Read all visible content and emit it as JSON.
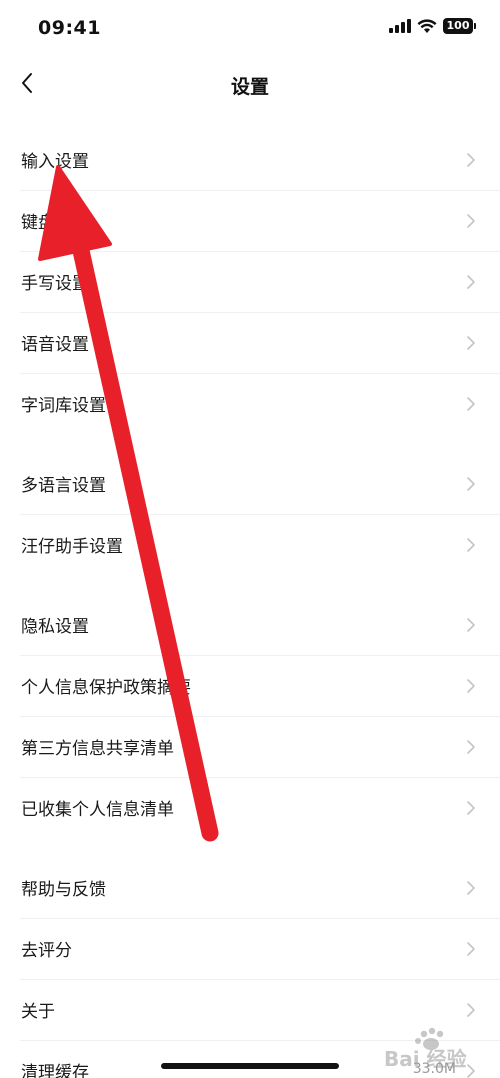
{
  "status_bar": {
    "time": "09:41",
    "battery": "100"
  },
  "nav": {
    "title": "设置"
  },
  "groups": [
    [
      {
        "label": "输入设置"
      },
      {
        "label": "键盘设置"
      },
      {
        "label": "手写设置"
      },
      {
        "label": "语音设置"
      },
      {
        "label": "字词库设置"
      }
    ],
    [
      {
        "label": "多语言设置"
      },
      {
        "label": "汪仔助手设置"
      }
    ],
    [
      {
        "label": "隐私设置"
      },
      {
        "label": "个人信息保护政策摘要"
      },
      {
        "label": "第三方信息共享清单"
      },
      {
        "label": "已收集个人信息清单"
      }
    ],
    [
      {
        "label": "帮助与反馈"
      },
      {
        "label": "去评分"
      },
      {
        "label": "关于"
      },
      {
        "label": "清理缓存",
        "value": "33.0M"
      }
    ]
  ],
  "icons": {
    "back": "chevron-left-icon",
    "row": "chevron-right-icon"
  },
  "colors": {
    "annotation_arrow": "#e8202a",
    "chevron": "#c4c4c4"
  },
  "watermark": {
    "text": "Bai 经验"
  }
}
